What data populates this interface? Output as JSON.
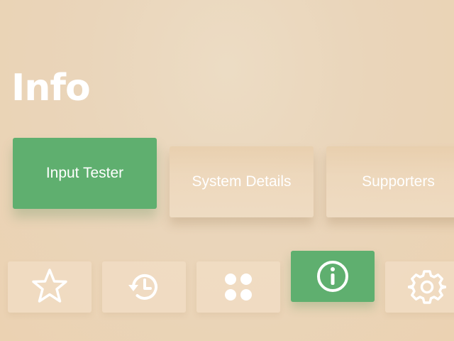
{
  "header": {
    "title": "Info"
  },
  "tiles": [
    {
      "label": "Input Tester",
      "selected": true
    },
    {
      "label": "System Details",
      "selected": false
    },
    {
      "label": "Supporters",
      "selected": false
    }
  ],
  "nav": [
    {
      "icon": "star-icon",
      "selected": false
    },
    {
      "icon": "history-icon",
      "selected": false
    },
    {
      "icon": "apps-icon",
      "selected": false
    },
    {
      "icon": "info-icon",
      "selected": true
    },
    {
      "icon": "gear-icon",
      "selected": false
    }
  ],
  "colors": {
    "accent": "#5faf6f",
    "background": "#ead5ba",
    "text": "#ffffff"
  }
}
